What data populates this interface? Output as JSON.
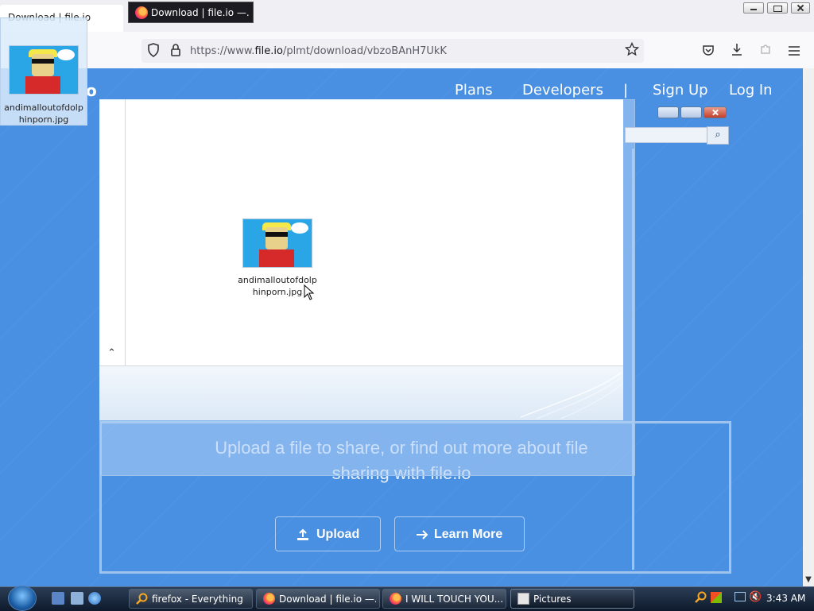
{
  "browser": {
    "ghost_tab_title": "Download | file.io",
    "active_tab_title": "Download | file.io —...",
    "url_prefix": "https://www.",
    "url_domain": "file.io",
    "url_path": "/plmt/download/vbzoBAnH7UkK"
  },
  "site": {
    "logo_fragment": "o",
    "nav": [
      "Plans",
      "Developers",
      "|",
      "Sign Up",
      "Log In"
    ],
    "hero_text": "Upload a file to share, or find out more about file sharing with file.io",
    "upload_label": "Upload",
    "learn_more_label": "Learn More"
  },
  "explorer": {
    "file_name_line1": "andimalloutofdolp",
    "file_name_line2": "hinporn.jpg"
  },
  "drag_item": {
    "name_line1": "andimalloutofdolp",
    "name_line2": "hinporn.jpg"
  },
  "taskbar": {
    "items": [
      {
        "label": "firefox - Everything"
      },
      {
        "label": "Download | file.io —..."
      },
      {
        "label": "I WILL TOUCH YOU..."
      },
      {
        "label": "Pictures"
      }
    ],
    "clock": "3:43 AM"
  }
}
